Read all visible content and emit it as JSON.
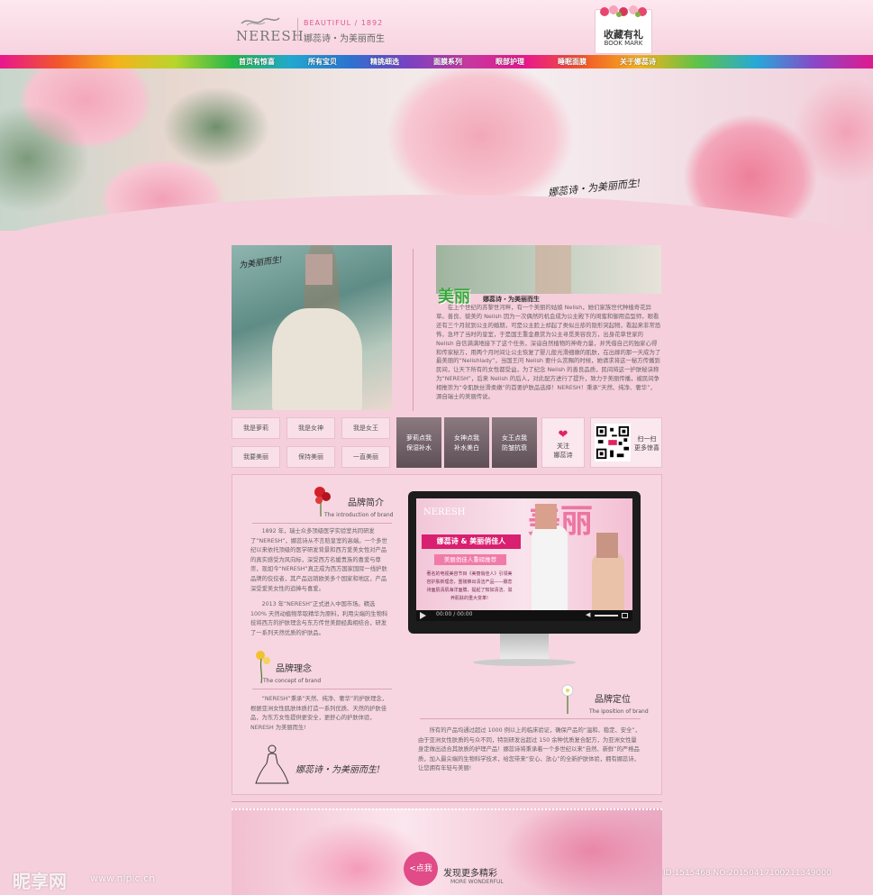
{
  "header": {
    "logo": "NERESH",
    "tagline_en": "BEAUTIFUL / 1892",
    "slogan": "娜蕊诗・为美丽而生",
    "bookmark_cn": "收藏有礼",
    "bookmark_en": "BOOK MARK"
  },
  "nav": {
    "items": [
      "首页有惊喜",
      "所有宝贝",
      "精挑细选",
      "面膜系列",
      "眼部护理",
      "睡眠面膜",
      "关于娜蕊诗"
    ]
  },
  "banner": {
    "script": "娜蕊诗・为美丽而生!"
  },
  "intro": {
    "photo_script": "为美丽而生!",
    "heading": "美丽",
    "heading_sub": "娜蕊诗・为美丽而生",
    "story": "在上个世纪的苏黎世河畔，有一个美丽的姑娘 Nelish，她们家族世代种植奇花异草。善良、貌美的 Nelish 因为一次偶然的机会成为公主殿下的闺蜜和御用造型师，眼看还有三个月就到公主的婚期，可是公主脸上却起了类似丘疹的隐形突起物，看起来非常恐怖，急坏了当时的皇室，于是国王重金悬赏为公主寻觅美容良方，出身花草世家的 Nelish 自信满满地接下了这个任务，深谙自然植物的神奇力量，并凭借自己的独家心得和传家秘方，用两个月时间让公主恢复了婴儿般光滑细嫩的肌肤，在出嫁的那一天成为了最美丽的“Nelishlady”，当国王问 Nelish 要什么赏赐的时候，她请求将这一秘方传播到民间，让天下所有的女性都受益，为了纪念 Nelish 的善良品质，民间将这一护肤秘诀称为“NERESH”，后来 Nelish 的后人，对此配方进行了提升，致力于美丽传播，被民间争相推崇为“令肌肤丝滑柔嫩”的首要护肤品选择！NERESH！秉承“天然、纯净、奢华”，源自瑞士的美丽传说。"
  },
  "quick_links": {
    "pills": [
      "我是萝莉",
      "我是女神",
      "我是女王",
      "我要美丽",
      "保持美丽",
      "一直美丽"
    ],
    "tiles": [
      {
        "line1": "萝莉点我",
        "line2": "保湿补水"
      },
      {
        "line1": "女神点我",
        "line2": "补水美白"
      },
      {
        "line1": "女王点我",
        "line2": "防皱抗衰"
      }
    ],
    "follow_line1": "关注",
    "follow_line2": "娜蕊诗",
    "qr_line1": "扫一扫",
    "qr_line2": "更多惊喜"
  },
  "brand": {
    "intro_title": "品牌简介",
    "intro_sub": "The introduction of brand",
    "intro_text": "1892 年，瑞士众多顶级医学实验室共同研发了“NERESH”，娜蕊诗从不言赔皇室的高端。一个多世纪以来依托顶级的医学研发背景和西方爱美女性对产品的真实感受为风向标，深受西方名媛贵族的喜爱与尊崇，现如今“NERESH”真正成为西方国家国际一线护肤品牌的佼佼者，其产品远销欧美多个国家和地区，产品深受爱美女性的追捧与喜爱。",
    "intro_text2": "2013 年“NERESH”正式进入中国市场。精选 100% 天然动植物萃取精华为原料，利用尖端的生物科技将西方的护肤理念与东方传世美颜经典相结合，研发了一系列天然优质的护肤品。",
    "concept_title": "品牌理念",
    "concept_sub": "The concept of brand",
    "concept_text": "“NERESH”秉承“天然、纯净、奢华”的护肤理念，根据亚洲女性肌肤体质打造一系列优质、天然的护肤佳品，为东方女性提供更安全，更舒心的护肤体验，NERESH 为美丽而生!",
    "concept_script": "娜蕊诗・为美丽而生!",
    "position_title": "品牌定位",
    "position_sub": "The iposition of brand",
    "position_text": "所有的产品均通过超过 1000 例以上的临床验证，确保产品的“温和、稳定、安全”，由于亚洲女性肤质的与众不同，特别研发出超过 150 余种优质复合配方，为亚洲女性量身定做出适合其肤质的护理产品！娜蕊诗将秉承着一个多世纪以来“自然、新鲜”的严格品质，加入最尖端的生物科学技术，给您带来“安心、放心”的全新护肤体验，拥有娜蕊诗，让您拥有年轻与美丽!"
  },
  "video": {
    "logo": "NERESH",
    "headline": "娜蕊诗 & 美丽俏佳人",
    "subhead": "美丽俏佳人重磅推荐",
    "desc": "著名的电视美容节目《美丽俏佳人》引领美容护肤新理念，重磅推出清洁产品——娜蕊诗面肌清肌海洋面膜，提起了知如清洁、滋养肌肤的重大变革!",
    "time": "00:00 / 00:00"
  },
  "footer": {
    "button": "<点我",
    "more_cn": "发现更多精彩",
    "more_en": "MORE WONDERFUL"
  },
  "watermark": {
    "site_cn": "昵享网",
    "url": "www.nipic.cn",
    "id": "ID:1515468 NO:20150417100211349000"
  }
}
